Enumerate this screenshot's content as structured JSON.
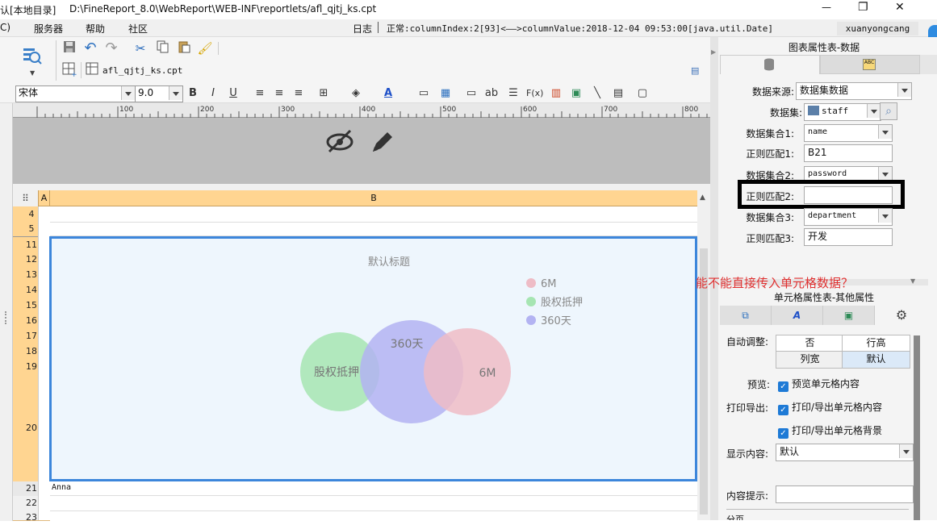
{
  "titlebar": {
    "left_title": "认[本地目录]",
    "path": "D:\\FineReport_8.0\\WebReport\\WEB-INF\\reportlets/afl_qjtj_ks.cpt",
    "minimize": "—",
    "restore": "❐",
    "close": "✕"
  },
  "menubar": {
    "items": [
      "C)",
      "服务器",
      "帮助",
      "社区"
    ],
    "log_label": "日志",
    "status": "正常:columnIndex:2[93]<——>columnValue:2018-12-04 09:53:00[java.util.Date]",
    "user": "xuanyongcang"
  },
  "toolbar": {
    "tab_file": "afl_qjtj_ks.cpt",
    "font_name": "宋体",
    "font_size": "9.0",
    "bold": "B",
    "italic": "I",
    "underline": "U",
    "text_ab": "ab",
    "formula": "F(x)",
    "font_color": "A"
  },
  "ruler": {
    "ticks": [
      "100",
      "200",
      "300",
      "400",
      "500",
      "600",
      "700",
      "800"
    ]
  },
  "grid": {
    "corner": "⠿",
    "col_a": "A",
    "col_b": "B",
    "rows": [
      "4",
      "5",
      "11",
      "12",
      "13",
      "14",
      "15",
      "16",
      "17",
      "18",
      "19",
      "20",
      "21",
      "22",
      "23"
    ],
    "cell_b21": "Anna"
  },
  "chart_data": {
    "type": "venn",
    "title": "默认标题",
    "sets": [
      {
        "name": "股权抵押",
        "color": "#a6e5b2"
      },
      {
        "name": "360天",
        "color": "#b3b3f2"
      },
      {
        "name": "6M",
        "color": "#eebcc6"
      }
    ],
    "legend": [
      "6M",
      "股权抵押",
      "360天"
    ],
    "legend_colors": [
      "#eebcc6",
      "#a6e5b2",
      "#b3b3f2"
    ],
    "legend_position": "top-right"
  },
  "annotation": {
    "question": "能不能直接传入单元格数据？",
    "color": "#e03030"
  },
  "chart_panel": {
    "title": "图表属性表-数据",
    "source_label": "数据来源:",
    "source_value": "数据集数据",
    "dataset_label": "数据集:",
    "dataset_value": "staff",
    "set1_label": "数据集合1:",
    "set1_value": "name",
    "regex1_label": "正则匹配1:",
    "regex1_value": "B21",
    "set2_label": "数据集合2:",
    "set2_value": "password",
    "regex2_label": "正则匹配2:",
    "regex2_value": "",
    "set3_label": "数据集合3:",
    "set3_value": "department",
    "regex3_label": "正则匹配3:",
    "regex3_value": "开发"
  },
  "cell_panel": {
    "title": "单元格属性表-其他属性",
    "auto_label": "自动调整:",
    "opt_no": "否",
    "opt_row": "行高",
    "opt_col": "列宽",
    "opt_default": "默认",
    "preview_label": "预览:",
    "preview_value": "预览单元格内容",
    "print_label": "打印导出:",
    "print_value": "打印/导出单元格内容",
    "print_bg": "打印/导出单元格背景",
    "display_label": "显示内容:",
    "display_value": "默认",
    "tooltip_label": "内容提示:",
    "tooltip_value": "",
    "page_label": "分页"
  }
}
